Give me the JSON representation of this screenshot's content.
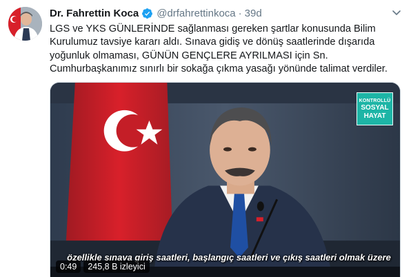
{
  "tweet": {
    "display_name": "Dr. Fahrettin Koca",
    "handle": "@drfahrettinkoca",
    "separator": "·",
    "time": "39d",
    "verified_icon": "verified-badge-icon",
    "menu_icon": "chevron-down-icon",
    "text_lines": [
      "LGS ve YKS GÜNLERİNDE sağlanması gereken şartlar konusunda Bilim",
      "Kurulumuz tavsiye kararı aldı. Sınava gidiş ve dönüş saatlerinde dışarıda",
      "yoğunluk olmaması, GÜNÜN GENÇLERE AYRILMASI için Sn.",
      "Cumhurbaşkanımız sınırlı bir sokağa çıkma yasağı yönünde talimat verdiler."
    ]
  },
  "video": {
    "logo_lines": [
      "KONTROLLÜ",
      "SOSYAL",
      "HAYAT"
    ],
    "caption": "özellikle sınava giriş saatleri, başlangıç saatleri ve çıkış saatleri olmak üzere",
    "duration": "0:49",
    "views": "245,8 B izleyici"
  },
  "colors": {
    "text": "#14171a",
    "secondary": "#657786",
    "verified": "#1da1f2",
    "logo_bg": "#1db5a6",
    "flag_red": "#d8202a"
  }
}
